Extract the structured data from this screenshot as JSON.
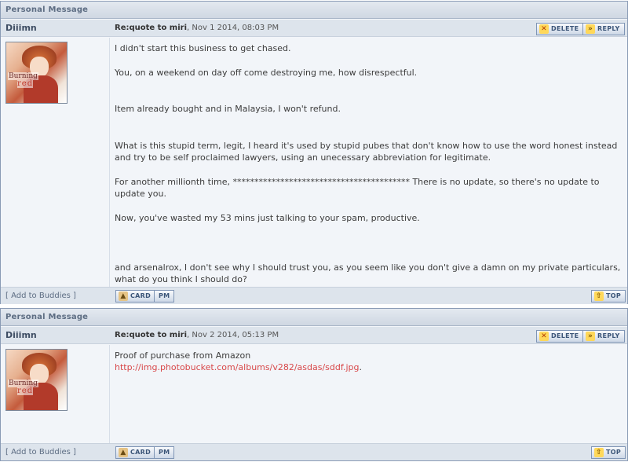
{
  "posts": [
    {
      "header": "Personal Message",
      "author": "Diiimn",
      "subject_label": "Re:quote to miri",
      "date": ", Nov 1 2014, 08:03 PM",
      "delete_label": "DELETE",
      "reply_label": "REPLY",
      "avatar_text1": "Burning",
      "avatar_text2": "red",
      "paragraphs": [
        "I didn't start this business to get chased.",
        "You, on a weekend on day off come destroying me, how disrespectful.",
        "Item already bought and in Malaysia, I won't refund.",
        "What is this stupid term, legit, I heard it's used by stupid pubes that don't know how to use the word honest instead and try to be self proclaimed lawyers, using an unecessary abbreviation for legitimate.",
        "For another millionth time, ***************************************** There is no update, so there's no update to update you.",
        "Now, you've wasted my 53 mins just talking to your spam, productive.",
        "and arsenalrox, I don't see why I should trust you, as you seem like you don't give a damn on my private particulars, what do you think I should do?"
      ],
      "add_buddy": "[ Add to Buddies ]",
      "card_label": "CARD",
      "pm_label": "PM",
      "top_label": "TOP"
    },
    {
      "header": "Personal Message",
      "author": "Diiimn",
      "subject_label": "Re:quote to miri",
      "date": ", Nov 2 2014, 05:13 PM",
      "delete_label": "DELETE",
      "reply_label": "REPLY",
      "avatar_text1": "Burning",
      "avatar_text2": "red",
      "line1": "Proof of purchase from Amazon",
      "link": "http://img.photobucket.com/albums/v282/asdas/sddf.jpg",
      "link_suffix": ".",
      "add_buddy": "[ Add to Buddies ]",
      "card_label": "CARD",
      "pm_label": "PM",
      "top_label": "TOP"
    }
  ],
  "colors": {
    "header_bg": "#cfd7e2",
    "row_bg": "#dde4ec",
    "body_bg": "#f2f5f9",
    "link": "#d8484a",
    "border": "#8a9bb5"
  }
}
